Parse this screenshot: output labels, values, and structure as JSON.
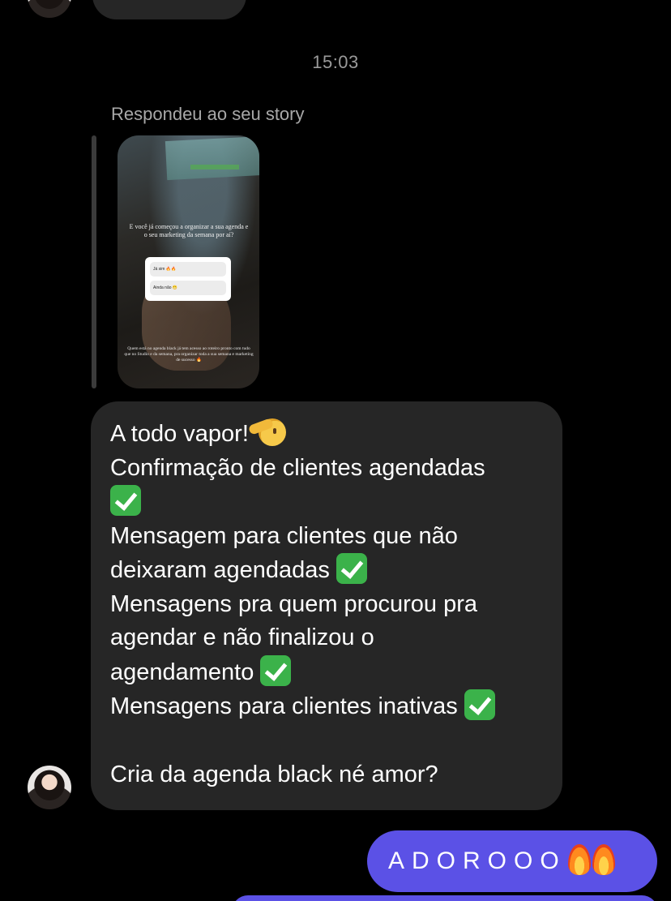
{
  "timestamp": "15:03",
  "reply": {
    "label": "Respondeu ao seu story"
  },
  "story": {
    "question": "E você já começou a organizar a sua agenda e o seu marketing da semana por aí?",
    "poll_options": [
      "Já sim 🔥🔥",
      "Ainda não 😬"
    ],
    "caption": "Quem está no agenda black já tem acesso ao roteiro pronto com tudo que no Studio e da semana, pra organizar toda a sua semana e marketing de sucesso 🔥"
  },
  "message": {
    "lines": [
      "A todo vapor!",
      "Confirmação de clientes agendadas",
      "Mensagem para clientes que não",
      "deixaram agendadas",
      "Mensagens pra quem procurou pra",
      "agendar e não finalizou o",
      "agendamento",
      "Mensagens para clientes inativas",
      "Cria da agenda black né amor?"
    ]
  },
  "sent": {
    "text": "ADOROOO"
  },
  "icons": {
    "check": "check-mark-button-emoji",
    "salute": "saluting-face-emoji",
    "fire": "fire-emoji"
  },
  "colors": {
    "background": "#000000",
    "received_bubble": "#262626",
    "sent_bubble": "#5b51e6",
    "check_green": "#3bb24a"
  }
}
